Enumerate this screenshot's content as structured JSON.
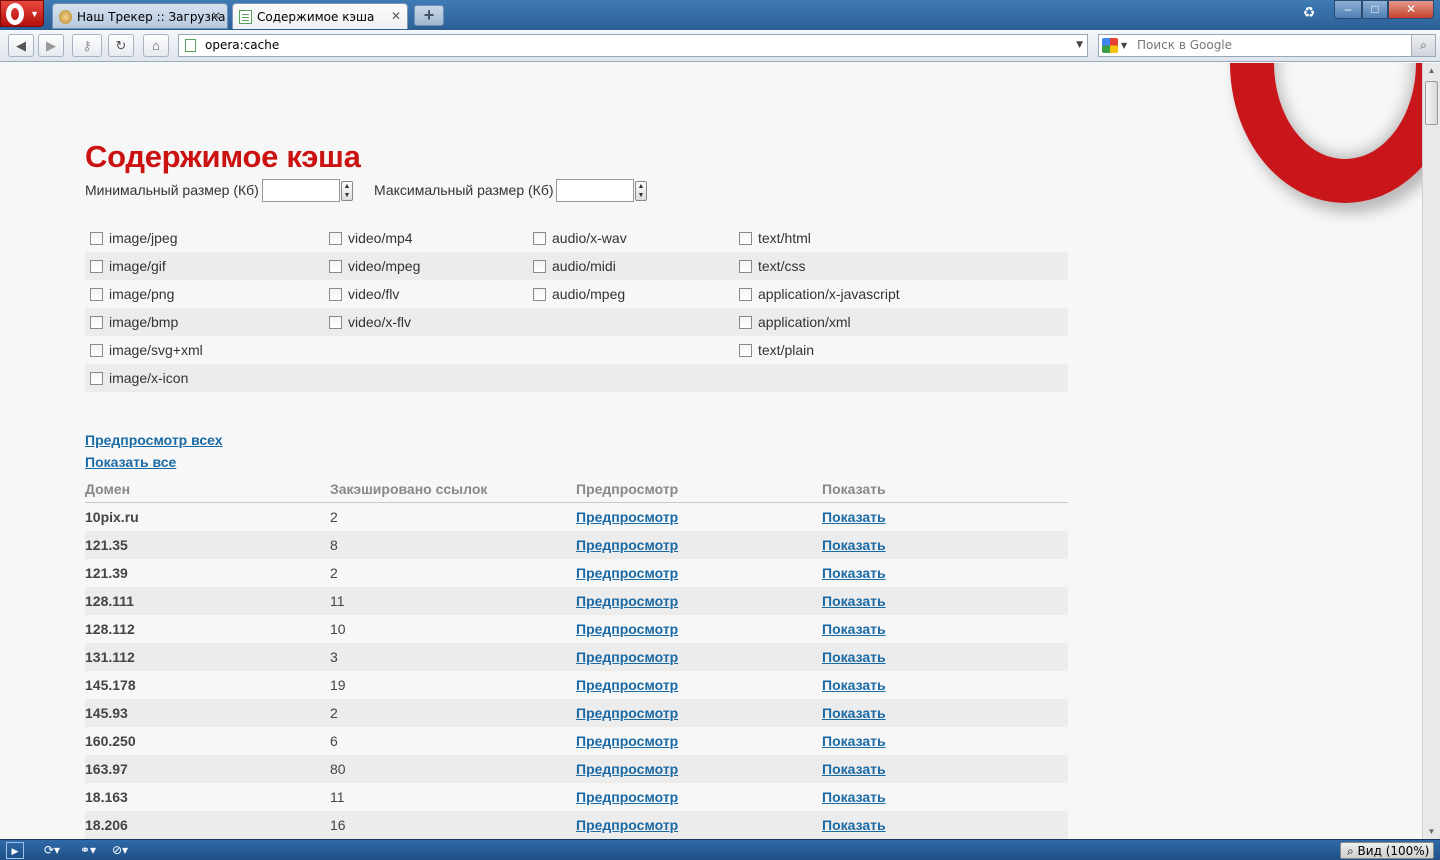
{
  "browser": {
    "tabs": [
      {
        "title": "Наш Трекер :: Загрузка",
        "active": false
      },
      {
        "title": "Содержимое кэша",
        "active": true
      }
    ],
    "address": "opera:cache",
    "search_placeholder": "Поиск в Google",
    "zoom_label": "Вид (100%)"
  },
  "page": {
    "title": "Содержимое кэша",
    "min_size_label": "Минимальный размер (Кб)",
    "max_size_label": "Максимальный размер (Кб)",
    "min_size_value": "",
    "max_size_value": "",
    "filters": [
      [
        "image/jpeg",
        "video/mp4",
        "audio/x-wav",
        "text/html"
      ],
      [
        "image/gif",
        "video/mpeg",
        "audio/midi",
        "text/css"
      ],
      [
        "image/png",
        "video/flv",
        "audio/mpeg",
        "application/x-javascript"
      ],
      [
        "image/bmp",
        "video/x-flv",
        "",
        "application/xml"
      ],
      [
        "image/svg+xml",
        "",
        "",
        "text/plain"
      ],
      [
        "image/x-icon",
        "",
        "",
        ""
      ]
    ],
    "preview_all_link": "Предпросмотр всех",
    "show_all_link": "Показать все",
    "table": {
      "headers": [
        "Домен",
        "Закэшировано ссылок",
        "Предпросмотр",
        "Показать"
      ],
      "preview_link": "Предпросмотр",
      "show_link": "Показать",
      "rows": [
        {
          "domain": "10pix.ru",
          "count": "2"
        },
        {
          "domain": "121.35",
          "count": "8"
        },
        {
          "domain": "121.39",
          "count": "2"
        },
        {
          "domain": "128.111",
          "count": "11"
        },
        {
          "domain": "128.112",
          "count": "10"
        },
        {
          "domain": "131.112",
          "count": "3"
        },
        {
          "domain": "145.178",
          "count": "19"
        },
        {
          "domain": "145.93",
          "count": "2"
        },
        {
          "domain": "160.250",
          "count": "6"
        },
        {
          "domain": "163.97",
          "count": "80"
        },
        {
          "domain": "18.163",
          "count": "11"
        },
        {
          "domain": "18.206",
          "count": "16"
        }
      ]
    }
  },
  "colors": {
    "title": "#cc1111",
    "link": "#1a6aa6",
    "row_alt": "#ececec"
  }
}
